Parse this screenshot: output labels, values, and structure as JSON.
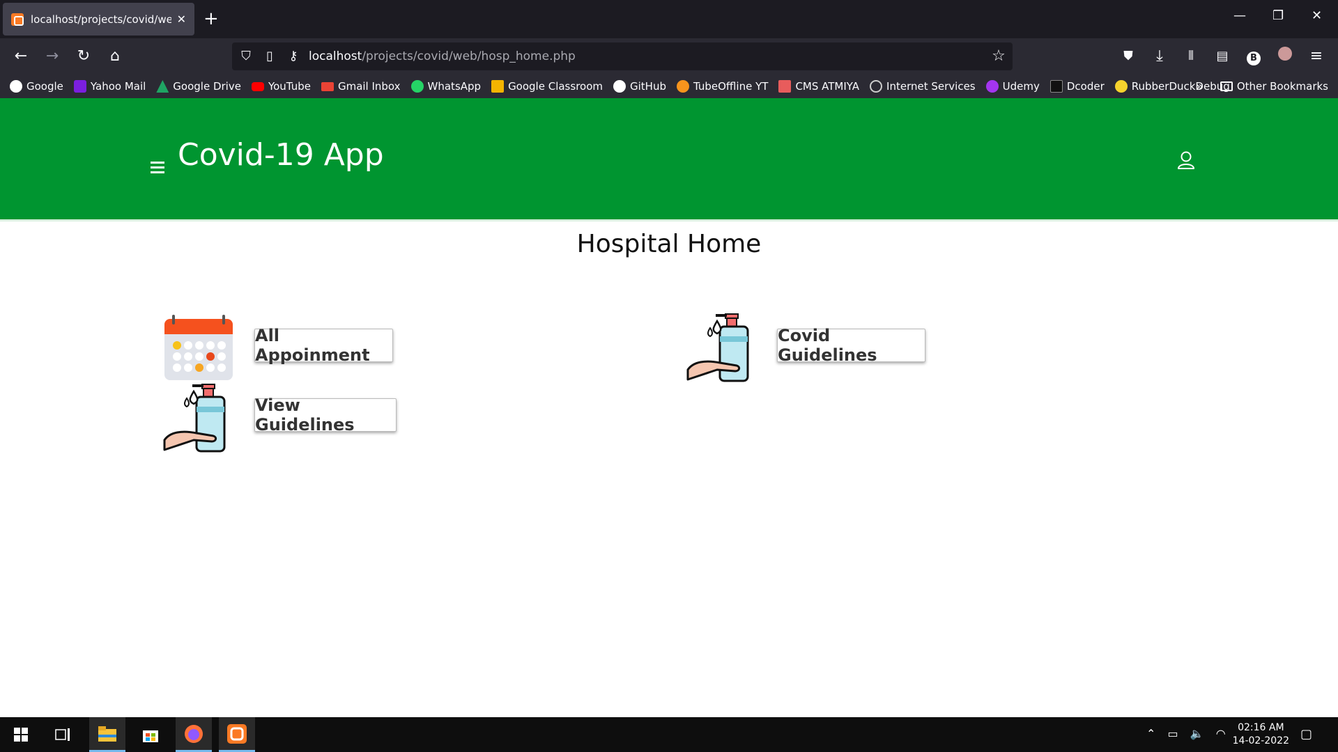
{
  "browser": {
    "tab_title": "localhost/projects/covid/web/h",
    "tab_close": "✕",
    "new_tab": "+",
    "url_host": "localhost",
    "url_path": "/projects/covid/web/hosp_home.php",
    "win_min": "—",
    "win_max": "❐",
    "win_close": "✕"
  },
  "bookmarks": [
    {
      "label": "Google",
      "color": "#ffffff"
    },
    {
      "label": "Yahoo Mail",
      "color": "#7b1fe0"
    },
    {
      "label": "Google Drive",
      "color": "#1fa463"
    },
    {
      "label": "YouTube",
      "color": "#ff0000"
    },
    {
      "label": "Gmail Inbox",
      "color": "#ea4335"
    },
    {
      "label": "WhatsApp",
      "color": "#25d366"
    },
    {
      "label": "Google Classroom",
      "color": "#f4b400"
    },
    {
      "label": "GitHub",
      "color": "#ffffff"
    },
    {
      "label": "TubeOffline YT",
      "color": "#f7941d"
    },
    {
      "label": "CMS ATMIYA",
      "color": "#e85c5c"
    },
    {
      "label": "Internet Services",
      "color": "#cccccc"
    },
    {
      "label": "Udemy",
      "color": "#a435f0"
    },
    {
      "label": "Dcoder",
      "color": "#111111"
    },
    {
      "label": "RubberDuckDebug",
      "color": "#f6d32d"
    }
  ],
  "other_bookmarks": "Other Bookmarks",
  "app": {
    "title": "Covid-19 App",
    "page_title": "Hospital Home",
    "buttons": {
      "all_appointment": "All Appoinment",
      "covid_guidelines": "Covid Guidelines",
      "view_guidelines": "View Guidelines"
    }
  },
  "taskbar": {
    "time": "02:16 AM",
    "date": "14-02-2022"
  },
  "colors": {
    "header_green": "#009530"
  }
}
